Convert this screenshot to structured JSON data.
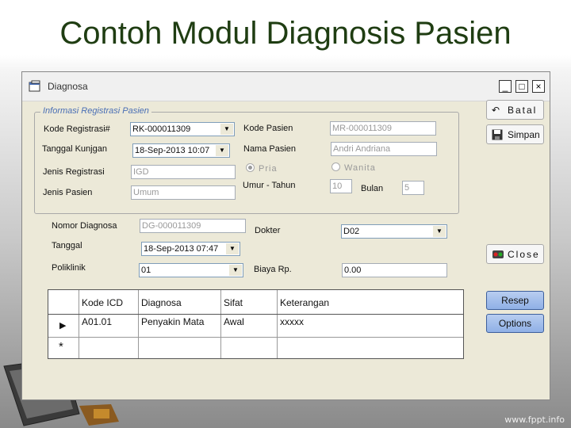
{
  "slide": {
    "title": "Contoh Modul Diagnosis Pasien",
    "footer": "www.fppt.info"
  },
  "window": {
    "title": "Diagnosa",
    "controls": {
      "minimize": "_",
      "maximize": "□",
      "close": "×"
    }
  },
  "registration": {
    "group_title": "Informasi Registrasi Pasien",
    "kode_registrasi": {
      "label": "Kode Registrasi#",
      "value": "RK-000011309"
    },
    "tanggal_kunjungan": {
      "label": "Tanggal Kunjgan",
      "value": "18-Sep-2013 10:07"
    },
    "jenis_registrasi": {
      "label": "Jenis Registrasi",
      "value": "IGD"
    },
    "jenis_pasien": {
      "label": "Jenis Pasien",
      "value": "Umum"
    },
    "kode_pasien": {
      "label": "Kode Pasien",
      "value": "MR-000011309"
    },
    "nama_pasien": {
      "label": "Nama Pasien",
      "value": "Andri Andriana"
    },
    "gender": {
      "pria": "Pria",
      "wanita": "Wanita",
      "selected": "Pria"
    },
    "umur": {
      "label": "Umur - Tahun",
      "value": "10"
    },
    "bulan": {
      "label": "Bulan",
      "value": "5"
    }
  },
  "diagnosa": {
    "nomor": {
      "label": "Nomor Diagnosa",
      "value": "DG-000011309"
    },
    "tanggal": {
      "label": "Tanggal",
      "value": "18-Sep-2013 07:47"
    },
    "poliklinik": {
      "label": "Poliklinik",
      "value": "01"
    },
    "dokter": {
      "label": "Dokter",
      "value": "D02"
    },
    "biaya": {
      "label": "Biaya Rp.",
      "value": "0.00"
    }
  },
  "table": {
    "headers": [
      "Kode ICD",
      "Diagnosa",
      "Sifat",
      "Keterangan"
    ],
    "rows": [
      [
        "A01.01",
        "Penyakin Mata",
        "Awal",
        "xxxxx"
      ]
    ],
    "current_row_marker": "▶",
    "new_row_marker": "*"
  },
  "buttons": {
    "batal": "Batal",
    "simpan": "Simpan",
    "close": "Close",
    "resep": "Resep",
    "options": "Options"
  }
}
